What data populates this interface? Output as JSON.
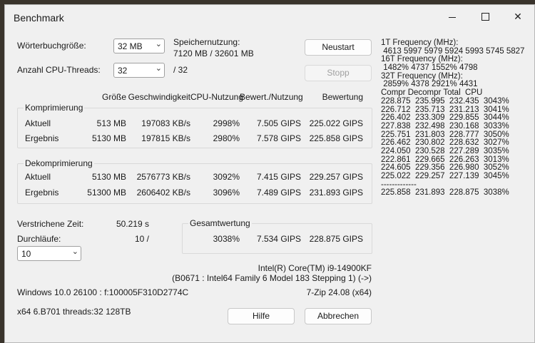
{
  "window": {
    "title": "Benchmark"
  },
  "dict": {
    "label": "Wörterbuchgröße:",
    "value": "32 MB"
  },
  "threads": {
    "label": "Anzahl CPU-Threads:",
    "value": "32",
    "max": "/ 32"
  },
  "memory": {
    "label": "Speichernutzung:",
    "value": "7120 MB / 32601 MB"
  },
  "buttons": {
    "restart": "Neustart",
    "stop": "Stopp",
    "help": "Hilfe",
    "cancel": "Abbrechen"
  },
  "columns": [
    "Größe",
    "Geschwindigkeit",
    "CPU-Nutzung",
    "Bewert./Nutzung",
    "Bewertung"
  ],
  "compress": {
    "title": "Komprimierung",
    "rows": [
      {
        "name": "Aktuell",
        "size": "513 MB",
        "speed": "197083 KB/s",
        "cpu": "2998%",
        "rpu": "7.505 GIPS",
        "rating": "225.022 GIPS"
      },
      {
        "name": "Ergebnis",
        "size": "5130 MB",
        "speed": "197815 KB/s",
        "cpu": "2980%",
        "rpu": "7.578 GIPS",
        "rating": "225.858 GIPS"
      }
    ]
  },
  "decompress": {
    "title": "Dekomprimierung",
    "rows": [
      {
        "name": "Aktuell",
        "size": "5130 MB",
        "speed": "2576773 KB/s",
        "cpu": "3092%",
        "rpu": "7.415 GIPS",
        "rating": "229.257 GIPS"
      },
      {
        "name": "Ergebnis",
        "size": "51300 MB",
        "speed": "2606402 KB/s",
        "cpu": "3096%",
        "rpu": "7.489 GIPS",
        "rating": "231.893 GIPS"
      }
    ]
  },
  "elapsed": {
    "label": "Verstrichene Zeit:",
    "value": "50.219 s"
  },
  "passes": {
    "label": "Durchläufe:",
    "value": "10 /",
    "combo": "10"
  },
  "total": {
    "title": "Gesamtwertung",
    "cpu": "3038%",
    "rpu": "7.534 GIPS",
    "rating": "228.875 GIPS"
  },
  "cpu_info": {
    "name": "Intel(R) Core(TM) i9-14900KF",
    "detail": "(B0671 : Intel64 Family 6 Model 183 Stepping 1) (->)"
  },
  "system": {
    "os": "Windows 10.0 26100 :  f:100005F310D2774C",
    "version": "7-Zip 24.08 (x64)",
    "arch": "x64 6.B701 threads:32 128TB"
  },
  "freq_lines": [
    "1T Frequency (MHz):",
    " 4613 5997 5979 5924 5993 5745 5827",
    "16T Frequency (MHz):",
    " 1482% 4737 1552% 4798",
    "32T Frequency (MHz):",
    " 2859% 4378 2921% 4431",
    "Compr Decompr Total  CPU",
    "228.875  235.995  232.435  3043%",
    "226.712  235.713  231.213  3041%",
    "226.402  233.309  229.855  3044%",
    "227.838  232.498  230.168  3033%",
    "225.751  231.803  228.777  3050%",
    "226.462  230.802  228.632  3027%",
    "224.050  230.528  227.289  3035%",
    "222.861  229.665  226.263  3013%",
    "224.605  229.356  226.980  3052%",
    "225.022  229.257  227.139  3045%",
    "-------------",
    "225.858  231.893  228.875  3038%"
  ]
}
